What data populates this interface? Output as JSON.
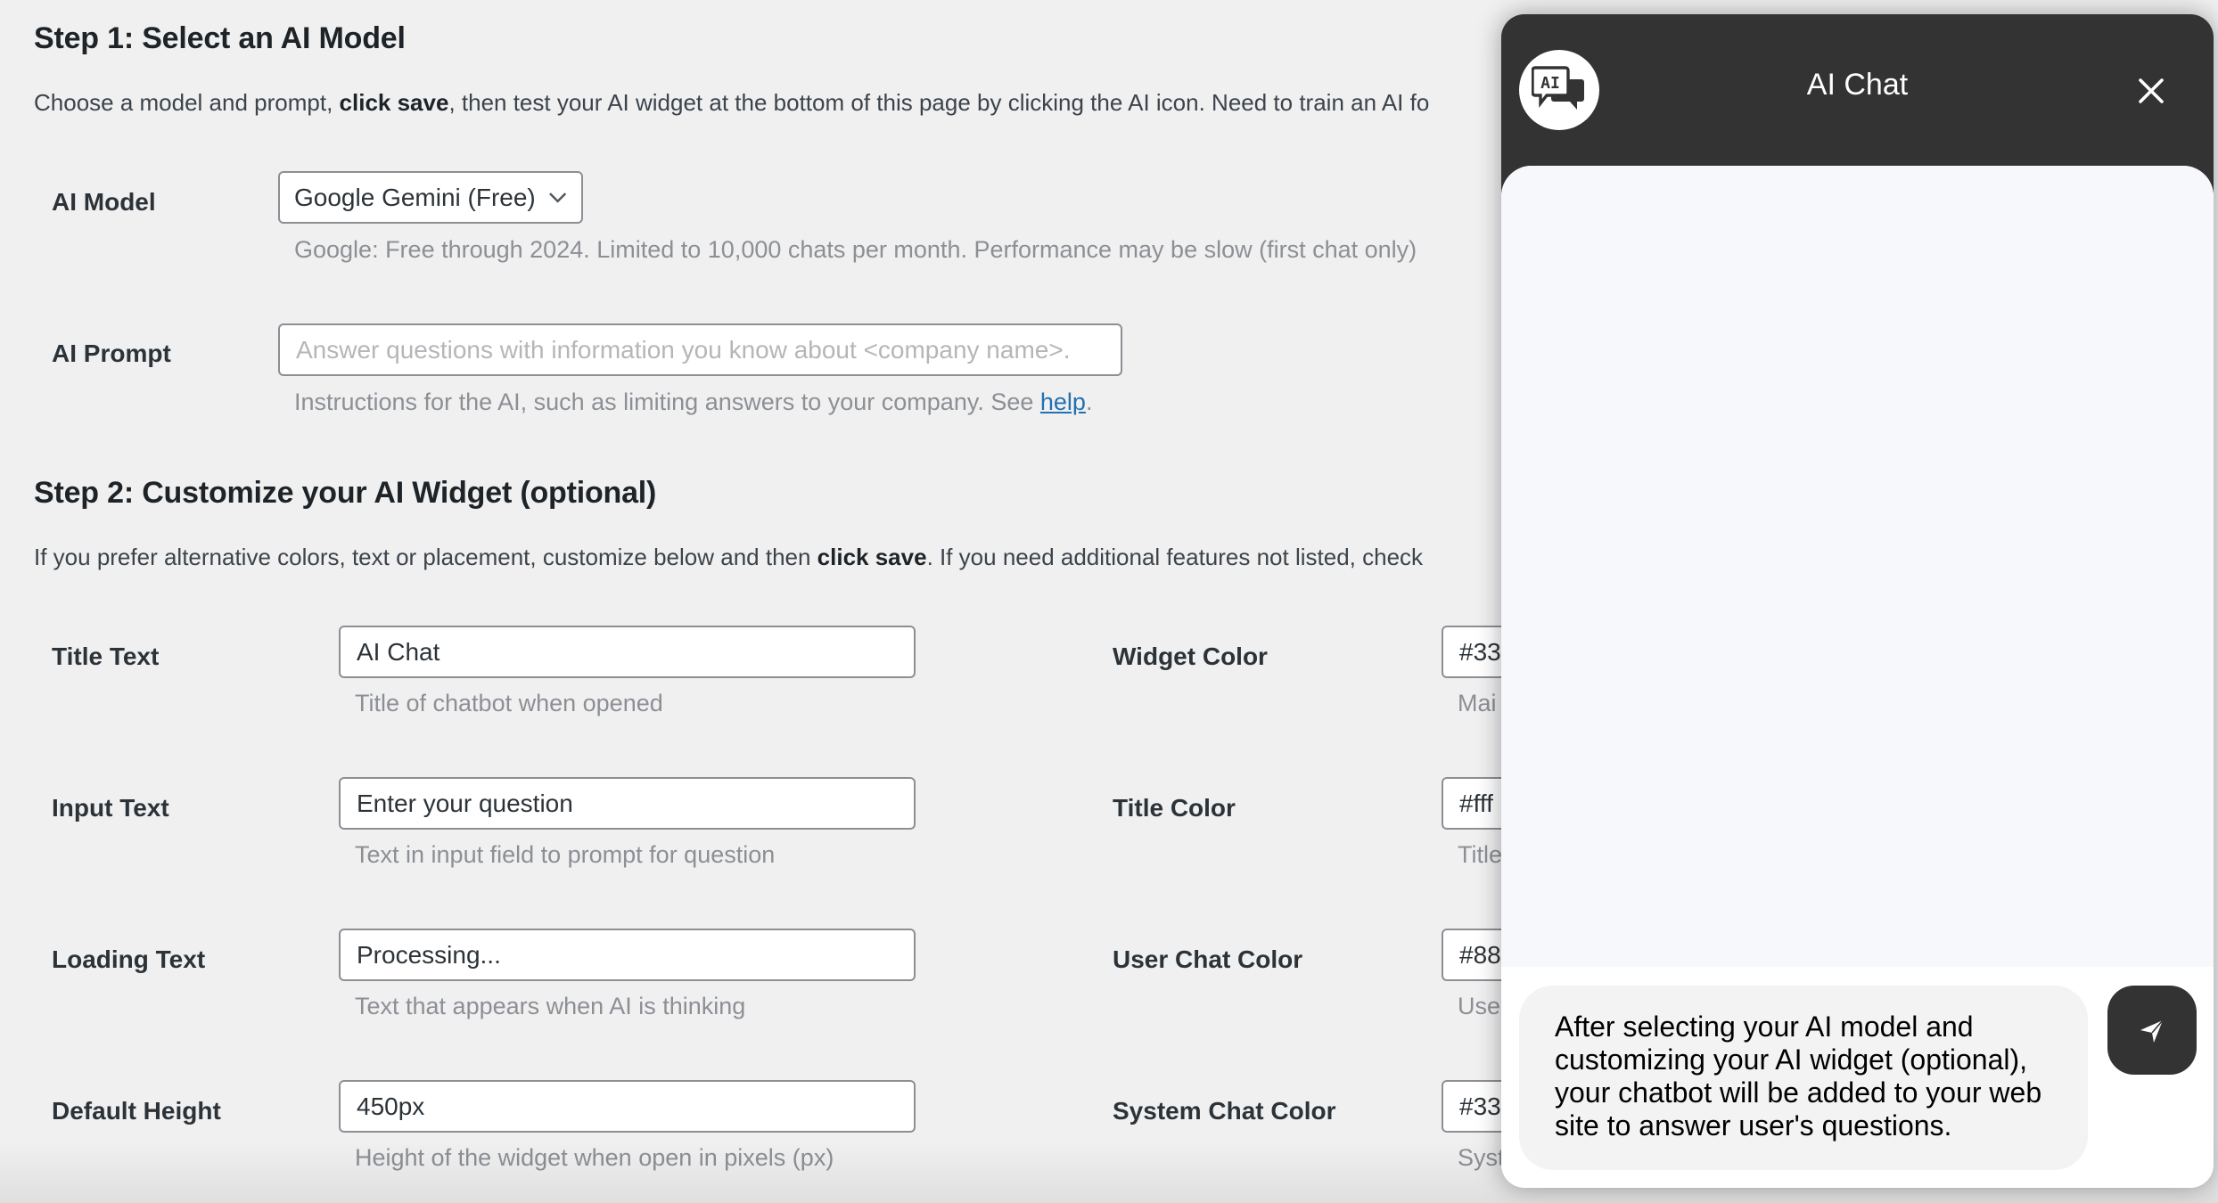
{
  "step1": {
    "heading": "Step 1: Select an AI Model",
    "intro_pre": "Choose a model and prompt, ",
    "intro_bold": "click save",
    "intro_post": ", then test your AI widget at the bottom of this page by clicking the AI icon. Need to train an AI fo",
    "model": {
      "label": "AI Model",
      "selected": "Google Gemini (Free)",
      "description": "Google: Free through 2024. Limited to 10,000 chats per month. Performance may be slow (first chat only)"
    },
    "prompt": {
      "label": "AI Prompt",
      "placeholder": "Answer questions with information you know about <company name>.",
      "value": "",
      "description_pre": "Instructions for the AI, such as limiting answers to your company. See ",
      "help_link": "help",
      "description_post": "."
    }
  },
  "step2": {
    "heading": "Step 2: Customize your AI Widget (optional)",
    "intro_pre": "If you prefer alternative colors, text or placement, customize below and then ",
    "intro_bold": "click save",
    "intro_post": ". If you need additional features not listed, check",
    "left_fields": [
      {
        "label": "Title Text",
        "value": "AI Chat",
        "description": "Title of chatbot when opened"
      },
      {
        "label": "Input Text",
        "value": "Enter your question",
        "description": "Text in input field to prompt for question"
      },
      {
        "label": "Loading Text",
        "value": "Processing...",
        "description": "Text that appears when AI is thinking"
      },
      {
        "label": "Default Height",
        "value": "450px",
        "description": "Height of the widget when open in pixels (px)"
      }
    ],
    "right_fields": [
      {
        "label": "Widget Color",
        "value": "#33",
        "description": "Mai"
      },
      {
        "label": "Title Color",
        "value": "#fff",
        "description": "Title"
      },
      {
        "label": "User Chat Color",
        "value": "#88",
        "description": "Use"
      },
      {
        "label": "System Chat Color",
        "value": "#33",
        "description": "Syst"
      }
    ]
  },
  "chat_widget": {
    "logo_icon": "ai-chat-bubbles-icon",
    "title": "AI Chat",
    "close_icon": "close-icon",
    "input_text": "After selecting your AI model and customizing your AI widget (optional), your chatbot will be added to your web site to answer user's questions.",
    "send_icon": "send-icon",
    "colors": {
      "header": "#333333",
      "title": "#ffffff",
      "messages_bg": "#f7f8fc"
    }
  }
}
